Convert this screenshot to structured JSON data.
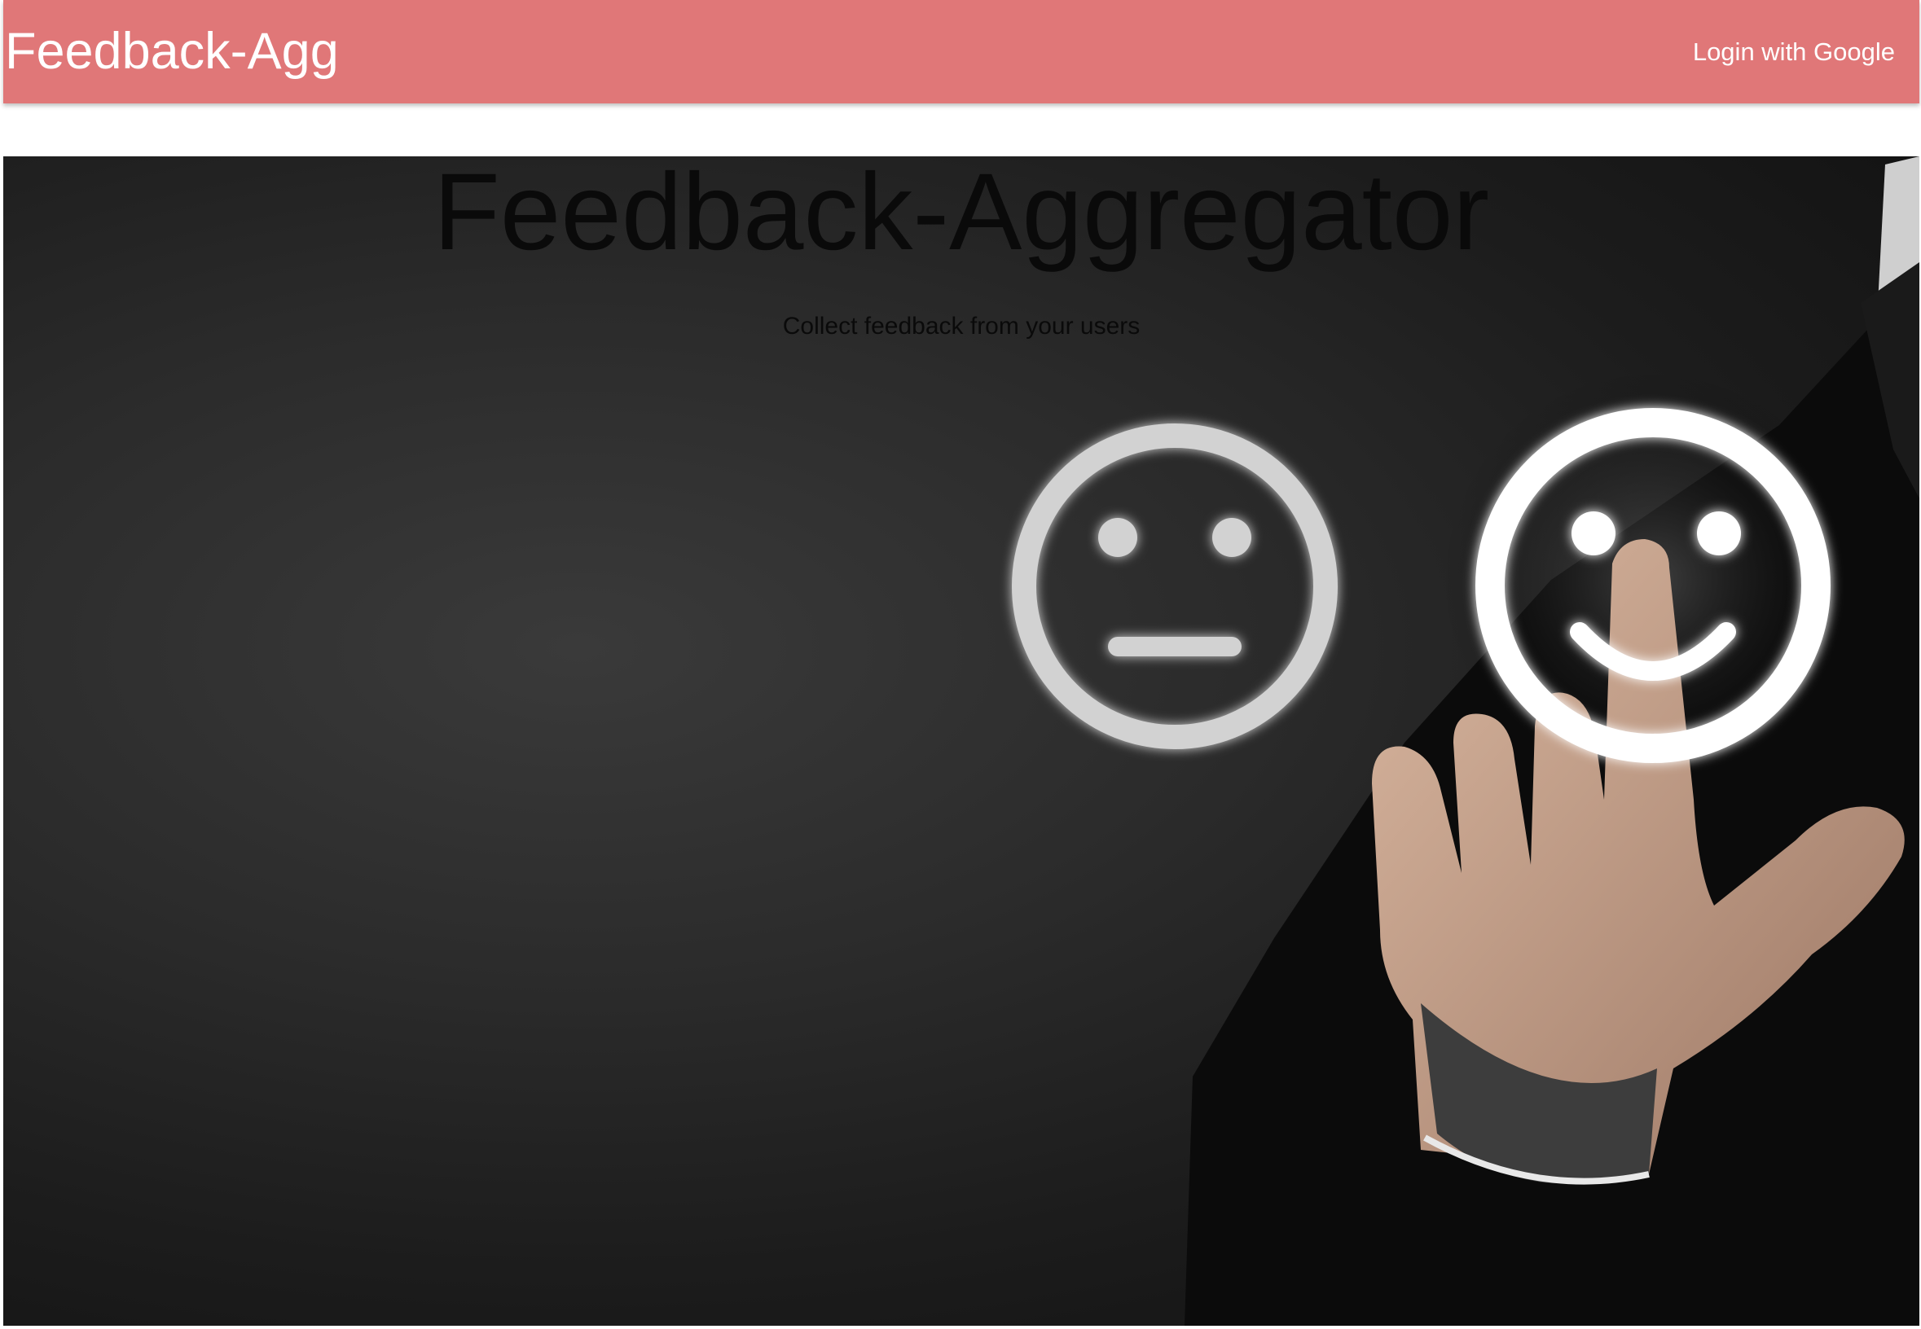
{
  "colors": {
    "navbar_bg": "#e07778",
    "navbar_text": "#ffffff",
    "hero_text": "#0a0a0a"
  },
  "navbar": {
    "brand": "Feedback-Agg",
    "login_label": "Login with Google"
  },
  "hero": {
    "title": "Feedback-Aggregator",
    "subtitle": "Collect feedback from your users",
    "image_icons": [
      "neutral-face-icon",
      "smiley-face-icon"
    ]
  }
}
